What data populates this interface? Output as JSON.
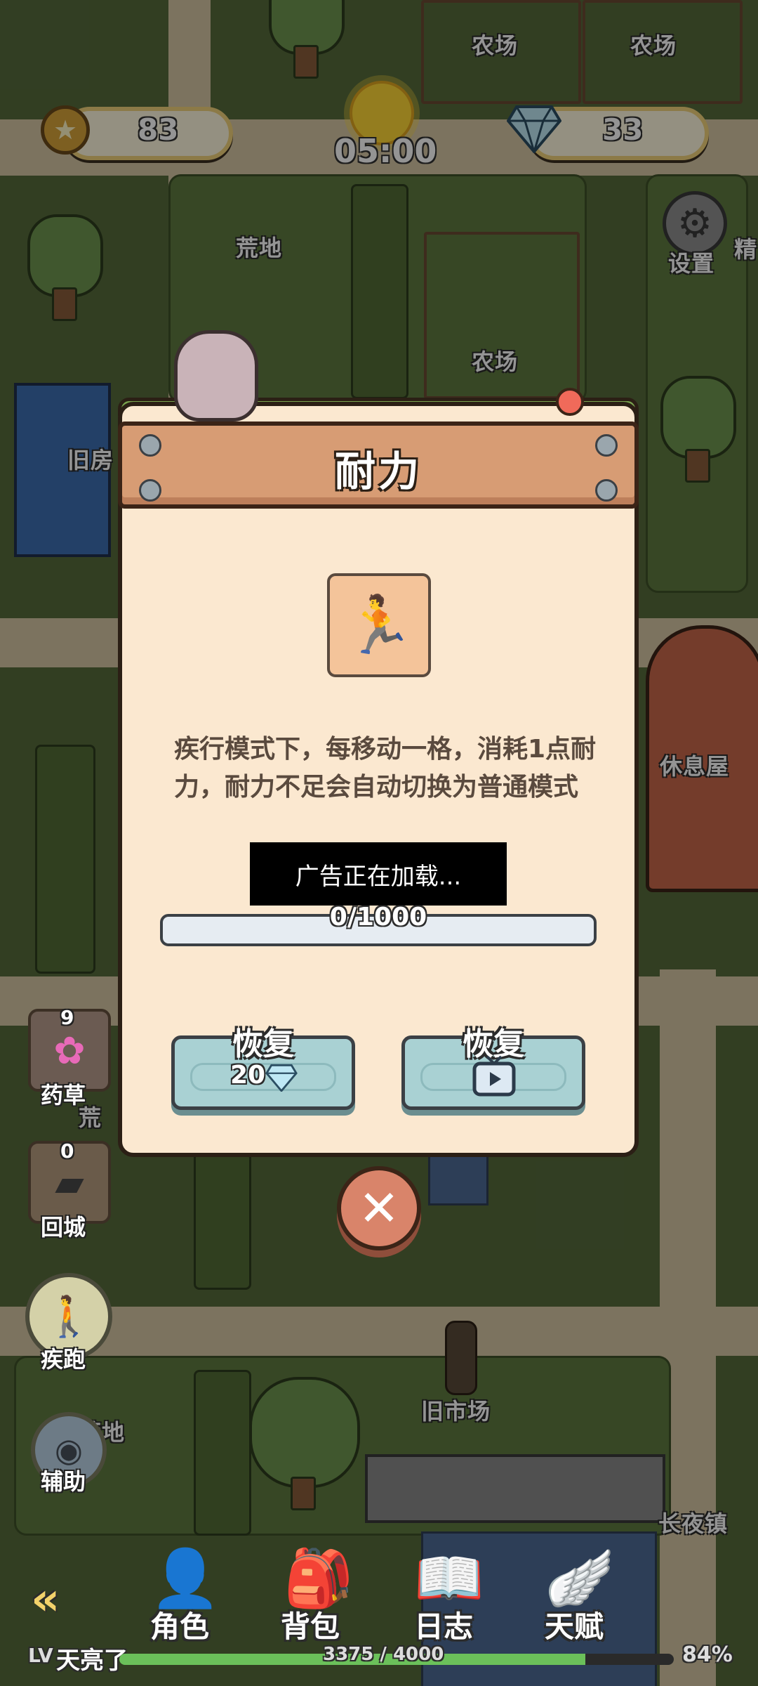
{
  "hud": {
    "coins": "83",
    "time": "05:00",
    "gems": "33",
    "settings_label": "设置"
  },
  "map_labels": {
    "farm1": "农场",
    "farm2": "农场",
    "farm3": "农场",
    "wasteland1": "荒地",
    "wasteland2": "荒",
    "wasteland3": "荒地",
    "old_house": "旧房",
    "rest_house": "休息屋",
    "old_market": "旧市场",
    "long_night_town": "长夜镇",
    "partial_right": "精"
  },
  "side": {
    "herb": {
      "count": "9",
      "label": "药草"
    },
    "return_city": {
      "count": "0",
      "label": "回城"
    },
    "sprint": {
      "label": "疾跑"
    },
    "assist": {
      "label": "辅助"
    }
  },
  "modal": {
    "title": "耐力",
    "description": "疾行模式下，每移动一格，消耗1点耐力，耐力不足会自动切换为普通模式",
    "ad_loading": "广告正在加载...",
    "progress_text": "0/1000",
    "progress_value": 0,
    "progress_max": 1000,
    "restore_gem_label": "恢复",
    "restore_gem_cost": "20",
    "restore_ad_label": "恢复"
  },
  "nav": {
    "character": "角色",
    "backpack": "背包",
    "journal": "日志",
    "talent": "天赋"
  },
  "status": {
    "level_prefix": "LV",
    "level_name": "天亮了",
    "xp": "3375 / 4000",
    "xp_fraction": 0.84,
    "battery": "84%"
  },
  "icons": {
    "coin": "star-coin-icon",
    "gem": "diamond-icon",
    "skill": "running-person-icon",
    "close": "close-x-icon",
    "video": "tv-play-icon"
  }
}
